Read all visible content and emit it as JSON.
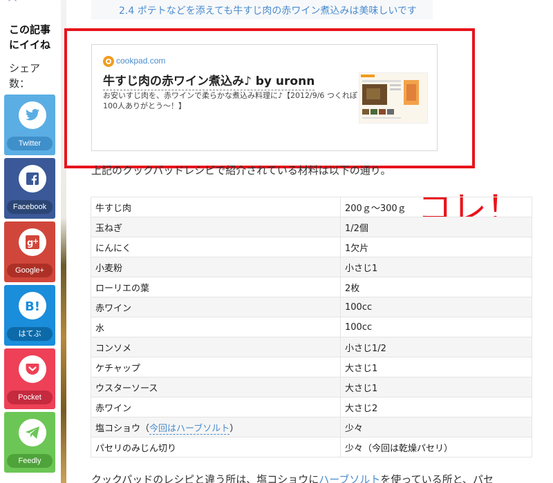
{
  "sidebar": {
    "like_title": "この記事にイイね",
    "share_label": "シェア数：",
    "buttons": [
      {
        "label": "Twitter",
        "icon": "twitter-bird-icon"
      },
      {
        "label": "Facebook",
        "icon": "facebook-f-icon"
      },
      {
        "label": "Google+",
        "icon": "google-plus-icon"
      },
      {
        "label": "はてぶ",
        "icon": "hatena-b-icon"
      },
      {
        "label": "Pocket",
        "icon": "pocket-icon"
      },
      {
        "label": "Feedly",
        "icon": "feedly-plane-icon"
      }
    ]
  },
  "toc": {
    "last_item": "2.4 ポテトなどを添えても牛すじ肉の赤ワイン煮込みは美味しいです"
  },
  "card": {
    "site": "cookpad.com",
    "title": "牛すじ肉の赤ワイン煮込み♪ by uronn",
    "description": "お安いすじ肉を、赤ワインで柔らかな煮込み料理に♪【2012/9/6 つくれぽ100人ありがとう〜！】"
  },
  "intro": "上記のクックパッドレシピで紹介されている材料は以下の通り。",
  "annotation": "コレ！",
  "ingredients": [
    {
      "name": "牛すじ肉",
      "amount": "200ｇ～300ｇ"
    },
    {
      "name": "玉ねぎ",
      "amount": "1/2個"
    },
    {
      "name": "にんにく",
      "amount": "1欠片"
    },
    {
      "name": "小麦粉",
      "amount": "小さじ1"
    },
    {
      "name": "ローリエの葉",
      "amount": "2枚"
    },
    {
      "name": "赤ワイン",
      "amount": "100cc"
    },
    {
      "name": "水",
      "amount": "100cc"
    },
    {
      "name": "コンソメ",
      "amount": "小さじ1/2"
    },
    {
      "name": "ケチャップ",
      "amount": "大さじ1"
    },
    {
      "name": "ウスターソース",
      "amount": "大さじ1"
    },
    {
      "name": "赤ワイン",
      "amount": "大さじ2"
    },
    {
      "name": "塩コショウ",
      "link": "今回はハーブソルト",
      "amount": "少々"
    },
    {
      "name": "パセリのみじん切り",
      "amount": "少々（今回は乾燥パセリ）"
    }
  ],
  "footer": {
    "before": "クックパッドのレシピと違う所は、塩コショウに",
    "link": "ハーブソルト",
    "after": "を使っている所と、パセ"
  },
  "colors": {
    "accent_link": "#4a8ccd",
    "highlight_red": "#e8141b"
  }
}
